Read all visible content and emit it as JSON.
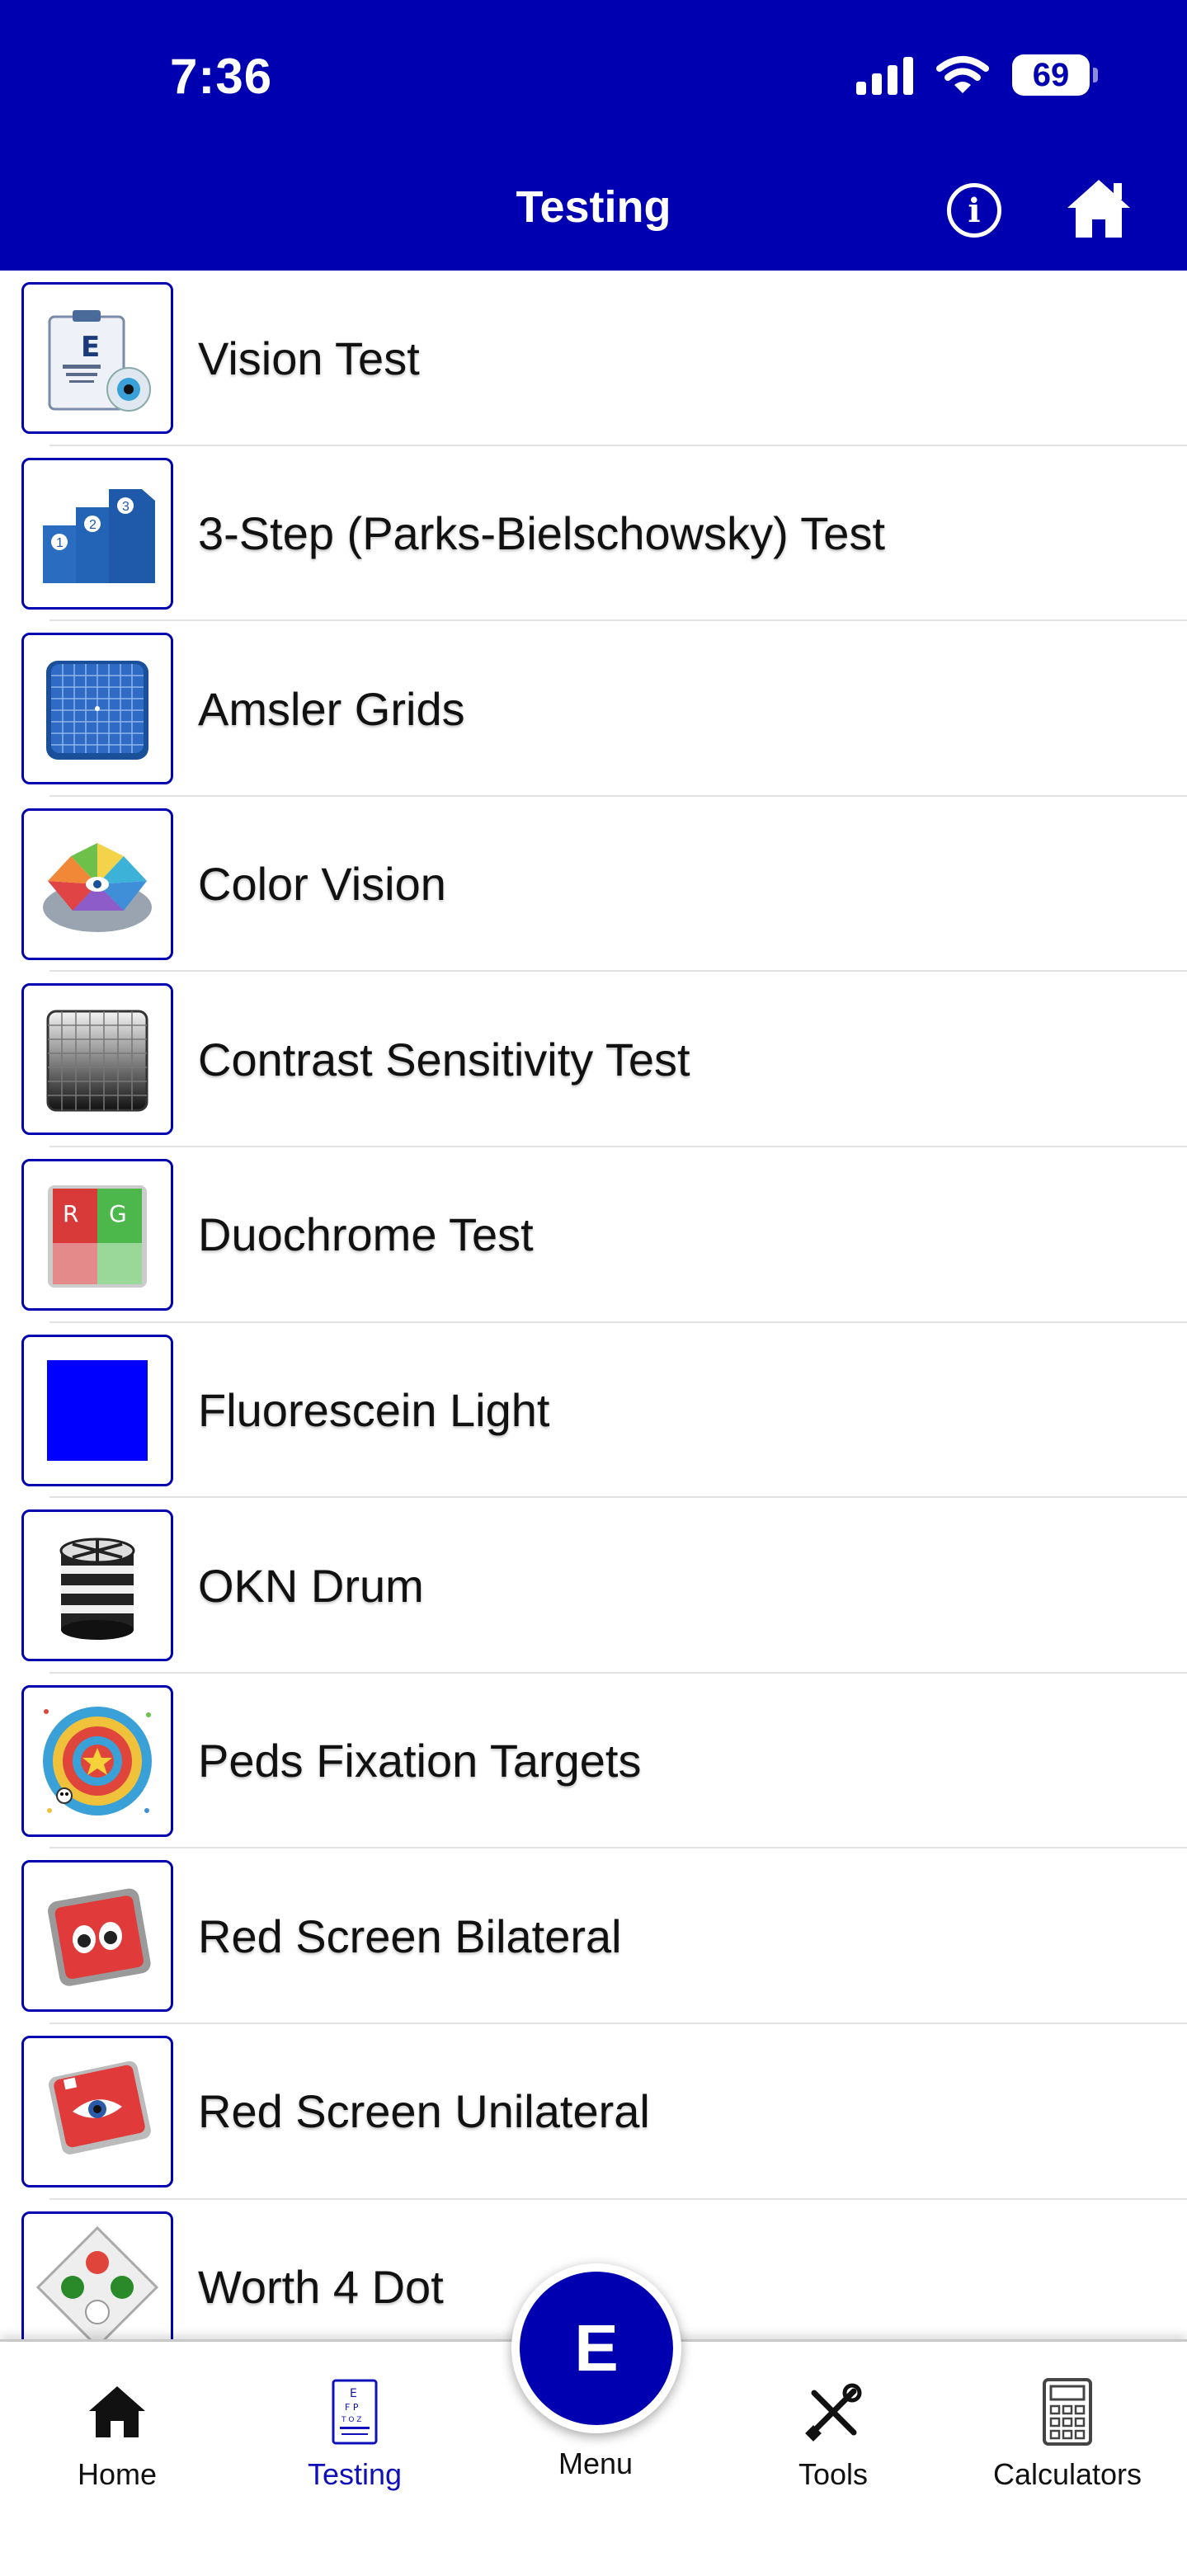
{
  "status_bar": {
    "time": "7:36",
    "battery": "69"
  },
  "header": {
    "title": "Testing"
  },
  "items": [
    {
      "label": "Vision Test",
      "icon": "eye-chart-icon"
    },
    {
      "label": "3-Step (Parks-Bielschowsky) Test",
      "icon": "steps-icon"
    },
    {
      "label": "Amsler Grids",
      "icon": "grid-icon"
    },
    {
      "label": "Color Vision",
      "icon": "color-wheel-icon"
    },
    {
      "label": "Contrast Sensitivity Test",
      "icon": "contrast-grid-icon"
    },
    {
      "label": "Duochrome Test",
      "icon": "duochrome-icon"
    },
    {
      "label": "Fluorescein Light",
      "icon": "blue-square-icon"
    },
    {
      "label": "OKN Drum",
      "icon": "drum-icon"
    },
    {
      "label": "Peds Fixation Targets",
      "icon": "target-icon"
    },
    {
      "label": "Red Screen Bilateral",
      "icon": "red-screen-eyes-icon"
    },
    {
      "label": "Red Screen Unilateral",
      "icon": "red-screen-eye-icon"
    },
    {
      "label": "Worth 4 Dot",
      "icon": "four-dot-icon"
    }
  ],
  "duochrome_letters": {
    "r": "R",
    "g": "G"
  },
  "tabbar": {
    "home": "Home",
    "testing": "Testing",
    "menu": "Menu",
    "menu_letter": "E",
    "tools": "Tools",
    "calculators": "Calculators"
  },
  "colors": {
    "brand_blue": "#0000b0",
    "active_tab": "#1010b8"
  }
}
